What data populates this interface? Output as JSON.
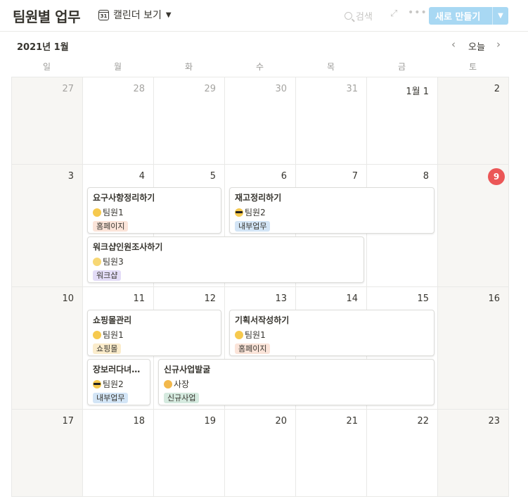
{
  "header": {
    "title": "팀원별 업무",
    "view_label": "캘린더 보기",
    "calendar_icon_text": "31",
    "search_label": "검색",
    "new_button_label": "새로 만들기"
  },
  "month_bar": {
    "month_label": "2021년 1월",
    "today_label": "오늘"
  },
  "weekdays": [
    "일",
    "월",
    "화",
    "수",
    "목",
    "금",
    "토"
  ],
  "weeks": [
    [
      "27",
      "28",
      "29",
      "30",
      "31",
      "1월 1",
      "2"
    ],
    [
      "3",
      "4",
      "5",
      "6",
      "7",
      "8",
      "9"
    ],
    [
      "10",
      "11",
      "12",
      "13",
      "14",
      "15",
      "16"
    ],
    [
      "17",
      "18",
      "19",
      "20",
      "21",
      "22",
      "23"
    ]
  ],
  "today_day": "9",
  "events": {
    "e1": {
      "title": "요구사항정리하기",
      "person": "팀원1",
      "tag": "홈페이지"
    },
    "e2": {
      "title": "재고정리하기",
      "person": "팀원2",
      "tag": "내부업무"
    },
    "e3": {
      "title": "워크샵인원조사하기",
      "person": "팀원3",
      "tag": "워크샵"
    },
    "e4": {
      "title": "쇼핑몰관리",
      "person": "팀원1",
      "tag": "쇼핑몰"
    },
    "e5": {
      "title": "기획서작성하기",
      "person": "팀원1",
      "tag": "홈페이지"
    },
    "e6": {
      "title": "장보러다녀오기",
      "person": "팀원2",
      "tag": "내부업무"
    },
    "e7": {
      "title": "신규사업발굴",
      "person": "사장",
      "tag": "신규사업"
    }
  },
  "colors": {
    "today_badge": "#eb5757",
    "new_button": "#a8d8f3",
    "tag_homepage": "#fbe4d9",
    "tag_internal": "#d3e5f6",
    "tag_workshop": "#e3dcf7",
    "tag_mall": "#fbeccb",
    "tag_newbiz": "#d5eadf"
  }
}
